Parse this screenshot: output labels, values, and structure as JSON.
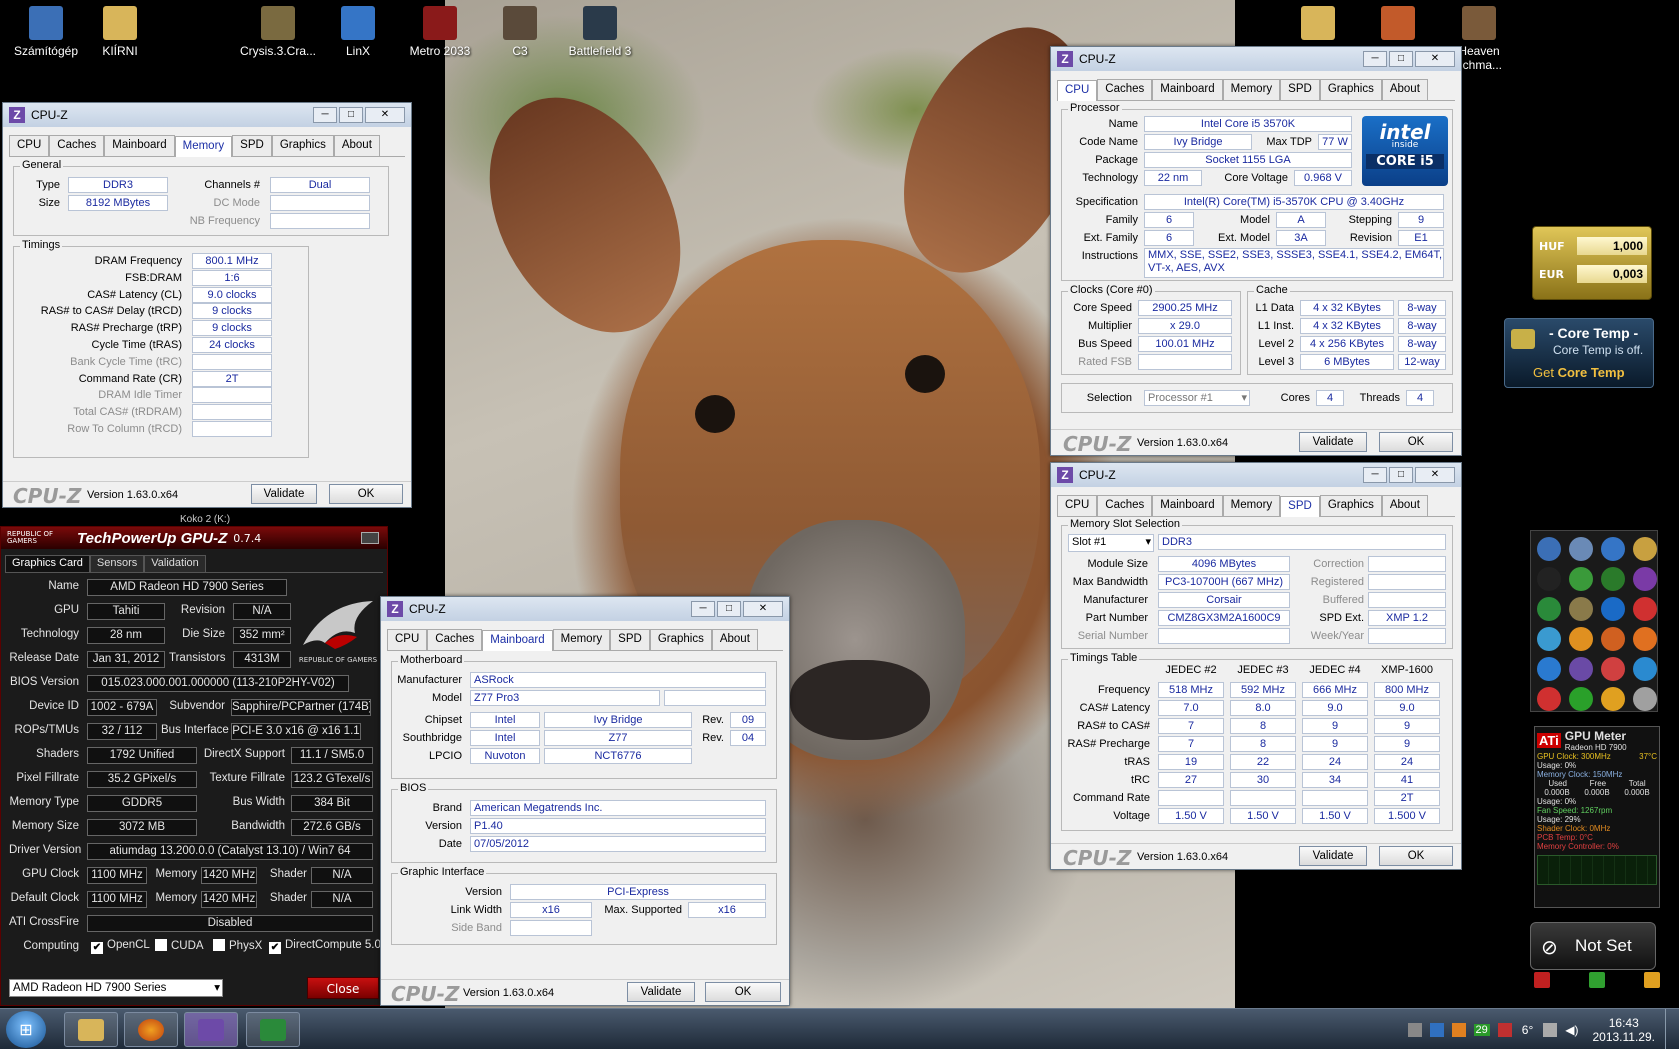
{
  "desktop": {
    "icons": [
      {
        "label": "Számítógép",
        "color": "#3b6fb6"
      },
      {
        "label": "KIÍRNI",
        "color": "#d8b55a"
      },
      {
        "label": "Crysis.3.Cra...",
        "color": "#7a6a40"
      },
      {
        "label": "LinX",
        "color": "#3575c6"
      },
      {
        "label": "Metro 2033",
        "color": "#8a1a1a"
      },
      {
        "label": "C3",
        "color": "#5a4a3a"
      },
      {
        "label": "Battlefield 3",
        "color": "#2a3a4a"
      },
      {
        "label": "",
        "color": "#d8b55a"
      },
      {
        "label": "",
        "color": "#c25a2a"
      },
      {
        "label": "Heaven",
        "sub": "nchma...",
        "color": "#7a5a3a"
      }
    ],
    "hidden_label": "Koko 2 (K:)"
  },
  "cpuz_memory": {
    "title": "CPU-Z",
    "tabs": [
      "CPU",
      "Caches",
      "Mainboard",
      "Memory",
      "SPD",
      "Graphics",
      "About"
    ],
    "active_tab": "Memory",
    "general": {
      "group": "General",
      "type_label": "Type",
      "type": "DDR3",
      "size_label": "Size",
      "size": "8192 MBytes",
      "channels_label": "Channels #",
      "channels": "Dual",
      "dc_mode_label": "DC Mode",
      "nb_freq_label": "NB Frequency"
    },
    "timings": {
      "group": "Timings",
      "rows": [
        {
          "label": "DRAM Frequency",
          "value": "800.1 MHz",
          "dim": false
        },
        {
          "label": "FSB:DRAM",
          "value": "1:6",
          "dim": false
        },
        {
          "label": "CAS# Latency (CL)",
          "value": "9.0 clocks",
          "dim": false
        },
        {
          "label": "RAS# to CAS# Delay (tRCD)",
          "value": "9 clocks",
          "dim": false
        },
        {
          "label": "RAS# Precharge (tRP)",
          "value": "9 clocks",
          "dim": false
        },
        {
          "label": "Cycle Time (tRAS)",
          "value": "24 clocks",
          "dim": false
        },
        {
          "label": "Bank Cycle Time (tRC)",
          "value": "",
          "dim": true
        },
        {
          "label": "Command Rate (CR)",
          "value": "2T",
          "dim": false
        },
        {
          "label": "DRAM Idle Timer",
          "value": "",
          "dim": true
        },
        {
          "label": "Total CAS# (tRDRAM)",
          "value": "",
          "dim": true
        },
        {
          "label": "Row To Column (tRCD)",
          "value": "",
          "dim": true
        }
      ]
    },
    "brand": "CPU-Z",
    "version": "Version 1.63.0.x64",
    "validate": "Validate",
    "ok": "OK"
  },
  "cpuz_cpu": {
    "title": "CPU-Z",
    "tabs": [
      "CPU",
      "Caches",
      "Mainboard",
      "Memory",
      "SPD",
      "Graphics",
      "About"
    ],
    "active_tab": "CPU",
    "processor_group": "Processor",
    "name_label": "Name",
    "name": "Intel Core i5 3570K",
    "codename_label": "Code Name",
    "codename": "Ivy Bridge",
    "maxtdp_label": "Max TDP",
    "maxtdp": "77 W",
    "package_label": "Package",
    "package": "Socket 1155 LGA",
    "tech_label": "Technology",
    "tech": "22 nm",
    "vcore_label": "Core Voltage",
    "vcore": "0.968 V",
    "spec_label": "Specification",
    "spec": "Intel(R) Core(TM) i5-3570K CPU @ 3.40GHz",
    "family_label": "Family",
    "family": "6",
    "model_label": "Model",
    "model": "A",
    "stepping_label": "Stepping",
    "stepping": "9",
    "extfamily_label": "Ext. Family",
    "extfamily": "6",
    "extmodel_label": "Ext. Model",
    "extmodel": "3A",
    "revision_label": "Revision",
    "revision": "E1",
    "instr_label": "Instructions",
    "instr1": "MMX, SSE, SSE2, SSE3, SSSE3, SSE4.1, SSE4.2, EM64T,",
    "instr2": "VT-x, AES, AVX",
    "badge_top": "intel",
    "badge_inside": "inside",
    "badge_bottom": "CORE i5",
    "clocks_group": "Clocks (Core #0)",
    "corespeed_label": "Core Speed",
    "corespeed": "2900.25 MHz",
    "multiplier_label": "Multiplier",
    "multiplier": "x 29.0",
    "busspeed_label": "Bus Speed",
    "busspeed": "100.01 MHz",
    "ratedfsb_label": "Rated FSB",
    "cache_group": "Cache",
    "cache": [
      {
        "label": "L1 Data",
        "size": "4 x 32 KBytes",
        "way": "8-way"
      },
      {
        "label": "L1 Inst.",
        "size": "4 x 32 KBytes",
        "way": "8-way"
      },
      {
        "label": "Level 2",
        "size": "4 x 256 KBytes",
        "way": "8-way"
      },
      {
        "label": "Level 3",
        "size": "6 MBytes",
        "way": "12-way"
      }
    ],
    "selection_label": "Selection",
    "selection": "Processor #1",
    "cores_label": "Cores",
    "cores": "4",
    "threads_label": "Threads",
    "threads": "4",
    "brand": "CPU-Z",
    "version": "Version 1.63.0.x64",
    "validate": "Validate",
    "ok": "OK"
  },
  "cpuz_spd": {
    "title": "CPU-Z",
    "tabs": [
      "CPU",
      "Caches",
      "Mainboard",
      "Memory",
      "SPD",
      "Graphics",
      "About"
    ],
    "active_tab": "SPD",
    "slot_group": "Memory Slot Selection",
    "slot": "Slot #1",
    "slot_type": "DDR3",
    "module_size_label": "Module Size",
    "module_size": "4096 MBytes",
    "max_bw_label": "Max Bandwidth",
    "max_bw": "PC3-10700H (667 MHz)",
    "manufacturer_label": "Manufacturer",
    "manufacturer": "Corsair",
    "part_label": "Part Number",
    "part": "CMZ8GX3M2A1600C9",
    "serial_label": "Serial Number",
    "correction_label": "Correction",
    "registered_label": "Registered",
    "buffered_label": "Buffered",
    "spdext_label": "SPD Ext.",
    "spdext": "XMP 1.2",
    "weekyear_label": "Week/Year",
    "timings_group": "Timings Table",
    "columns": [
      "JEDEC #2",
      "JEDEC #3",
      "JEDEC #4",
      "XMP-1600"
    ],
    "rows": [
      {
        "label": "Frequency",
        "cells": [
          "518 MHz",
          "592 MHz",
          "666 MHz",
          "800 MHz"
        ]
      },
      {
        "label": "CAS# Latency",
        "cells": [
          "7.0",
          "8.0",
          "9.0",
          "9.0"
        ]
      },
      {
        "label": "RAS# to CAS#",
        "cells": [
          "7",
          "8",
          "9",
          "9"
        ]
      },
      {
        "label": "RAS# Precharge",
        "cells": [
          "7",
          "8",
          "9",
          "9"
        ]
      },
      {
        "label": "tRAS",
        "cells": [
          "19",
          "22",
          "24",
          "24"
        ]
      },
      {
        "label": "tRC",
        "cells": [
          "27",
          "30",
          "34",
          "41"
        ]
      },
      {
        "label": "Command Rate",
        "cells": [
          "",
          "",
          "",
          "2T"
        ]
      },
      {
        "label": "Voltage",
        "cells": [
          "1.50 V",
          "1.50 V",
          "1.50 V",
          "1.500 V"
        ]
      }
    ],
    "brand": "CPU-Z",
    "version": "Version 1.63.0.x64",
    "validate": "Validate",
    "ok": "OK"
  },
  "cpuz_mainboard": {
    "title": "CPU-Z",
    "tabs": [
      "CPU",
      "Caches",
      "Mainboard",
      "Memory",
      "SPD",
      "Graphics",
      "About"
    ],
    "active_tab": "Mainboard",
    "mb_group": "Motherboard",
    "manufacturer_label": "Manufacturer",
    "manufacturer": "ASRock",
    "model_label": "Model",
    "model": "Z77 Pro3",
    "chipset_label": "Chipset",
    "chipset_vendor": "Intel",
    "chipset_name": "Ivy Bridge",
    "chipset_rev_label": "Rev.",
    "chipset_rev": "09",
    "south_label": "Southbridge",
    "south_vendor": "Intel",
    "south_name": "Z77",
    "south_rev_label": "Rev.",
    "south_rev": "04",
    "lpcio_label": "LPCIO",
    "lpcio_vendor": "Nuvoton",
    "lpcio_name": "NCT6776",
    "bios_group": "BIOS",
    "brand_label": "Brand",
    "bios_brand": "American Megatrends Inc.",
    "version_label": "Version",
    "bios_version": "P1.40",
    "date_label": "Date",
    "bios_date": "07/05/2012",
    "gi_group": "Graphic Interface",
    "gi_version_label": "Version",
    "gi_version": "PCI-Express",
    "link_label": "Link Width",
    "link": "x16",
    "maxsup_label": "Max. Supported",
    "maxsup": "x16",
    "sideband_label": "Side Band",
    "brand": "CPU-Z",
    "version": "Version 1.63.0.x64",
    "validate": "Validate",
    "ok": "OK"
  },
  "gpuz": {
    "rog": "REPUBLIC OF GAMERS",
    "title": "TechPowerUp GPU-Z",
    "version": "0.7.4",
    "tabs": [
      "Graphics Card",
      "Sensors",
      "Validation"
    ],
    "name_label": "Name",
    "name": "AMD Radeon HD 7900 Series",
    "gpu_label": "GPU",
    "gpu": "Tahiti",
    "revision_label": "Revision",
    "revision": "N/A",
    "tech_label": "Technology",
    "tech": "28 nm",
    "die_label": "Die Size",
    "die": "352 mm²",
    "release_label": "Release Date",
    "release": "Jan 31, 2012",
    "trans_label": "Transistors",
    "trans": "4313M",
    "bios_label": "BIOS Version",
    "bios": "015.023.000.001.000000 (113-210P2HY-V02)",
    "devid_label": "Device ID",
    "devid": "1002 - 679A",
    "subv_label": "Subvendor",
    "subv": "Sapphire/PCPartner (174B)",
    "rops_label": "ROPs/TMUs",
    "rops": "32 / 112",
    "bus_label": "Bus Interface",
    "bus": "PCI-E 3.0 x16 @ x16 1.1",
    "shaders_label": "Shaders",
    "shaders": "1792 Unified",
    "dx_label": "DirectX Support",
    "dx": "11.1 / SM5.0",
    "pixel_label": "Pixel Fillrate",
    "pixel": "35.2 GPixel/s",
    "texture_label": "Texture Fillrate",
    "texture": "123.2 GTexel/s",
    "memtype_label": "Memory Type",
    "memtype": "GDDR5",
    "buswidth_label": "Bus Width",
    "buswidth": "384 Bit",
    "memsize_label": "Memory Size",
    "memsize": "3072 MB",
    "bandwidth_label": "Bandwidth",
    "bandwidth": "272.6 GB/s",
    "driver_label": "Driver Version",
    "driver": "atiumdag 13.200.0.0 (Catalyst 13.10) / Win7 64",
    "gpuclock_label": "GPU Clock",
    "gpuclock": "1100 MHz",
    "mem_label": "Memory",
    "memclock": "1420 MHz",
    "shader_label": "Shader",
    "shader": "N/A",
    "defclock_label": "Default Clock",
    "defclock": "1100 MHz",
    "defmem": "1420 MHz",
    "defshader": "N/A",
    "crossfire_label": "ATI CrossFire",
    "crossfire": "Disabled",
    "computing_label": "Computing",
    "computing": [
      {
        "label": "OpenCL",
        "checked": true
      },
      {
        "label": "CUDA",
        "checked": false
      },
      {
        "label": "PhysX",
        "checked": false
      },
      {
        "label": "DirectCompute 5.0",
        "checked": true
      }
    ],
    "select": "AMD Radeon HD 7900 Series",
    "close": "Close",
    "rog_logo": "REPUBLIC OF GAMERS"
  },
  "currency": {
    "rows": [
      {
        "code": "HUF",
        "value": "1,000"
      },
      {
        "code": "EUR",
        "value": "0,003"
      }
    ]
  },
  "coretemp": {
    "title": "- Core Temp -",
    "status": "Core Temp is off.",
    "get": "Get",
    "get_brand": "Core Temp"
  },
  "gpumeter": {
    "title": "GPU Meter",
    "subtitle": "Radeon HD 7900",
    "gpu_clock": "GPU Clock: 300MHz",
    "temp": "37°C",
    "usage": "Usage: 0%",
    "mem_clock": "Memory Clock: 150MHz",
    "used_label": "Used",
    "free_label": "Free",
    "total_label": "Total",
    "used": "0.000B",
    "free": "0.000B",
    "total": "0.000B",
    "mem_usage": "Usage: 0%",
    "fan": "Fan Speed: 1267rpm",
    "fan_usage": "Usage: 29%",
    "shader_clock": "Shader Clock: 0MHz",
    "pcb_temp": "PCB Temp: 0°C",
    "mem_ctrl": "Memory Controller: 0%"
  },
  "notset": {
    "label": "Not Set"
  },
  "taskbar": {
    "clock_time": "16:43",
    "clock_date": "2013.11.29.",
    "temp": "6°",
    "tray_badge": "29"
  }
}
